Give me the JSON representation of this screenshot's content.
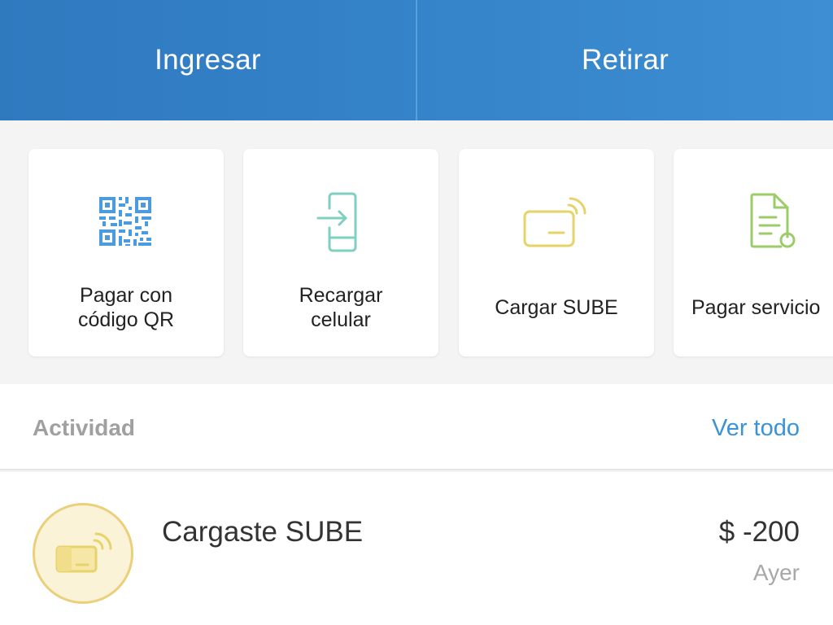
{
  "actions": {
    "deposit_label": "Ingresar",
    "withdraw_label": "Retirar"
  },
  "shortcuts": [
    {
      "label": "Pagar con\ncódigo QR",
      "icon": "qr-code-icon",
      "color": "#4a9be0"
    },
    {
      "label": "Recargar\ncelular",
      "icon": "phone-recharge-icon",
      "color": "#7fd0c0"
    },
    {
      "label": "Cargar SUBE",
      "icon": "sube-card-icon",
      "color": "#e6d36a"
    },
    {
      "label": "Pagar servicio",
      "icon": "bill-document-icon",
      "color": "#9ccc6a"
    }
  ],
  "activity": {
    "title": "Actividad",
    "see_all_label": "Ver todo",
    "items": [
      {
        "title": "Cargaste SUBE",
        "amount": "$ -200",
        "date": "Ayer",
        "icon": "sube-card-icon"
      }
    ]
  },
  "colors": {
    "header_blue": "#3583c9",
    "link_blue": "#3a93d6",
    "sube_yellow": "#e6d36a"
  }
}
